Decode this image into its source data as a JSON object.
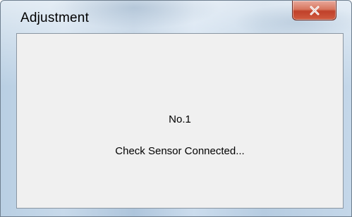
{
  "window": {
    "title": "Adjustment",
    "close_button": {
      "icon": "close-icon",
      "glyph": "x"
    }
  },
  "content": {
    "line1": "No.1",
    "line2": "Check Sensor Connected..."
  },
  "colors": {
    "client_background": "#f0f0f0",
    "close_button_red": "#c0412a",
    "title_bar_blue": "#b9cfe3"
  }
}
